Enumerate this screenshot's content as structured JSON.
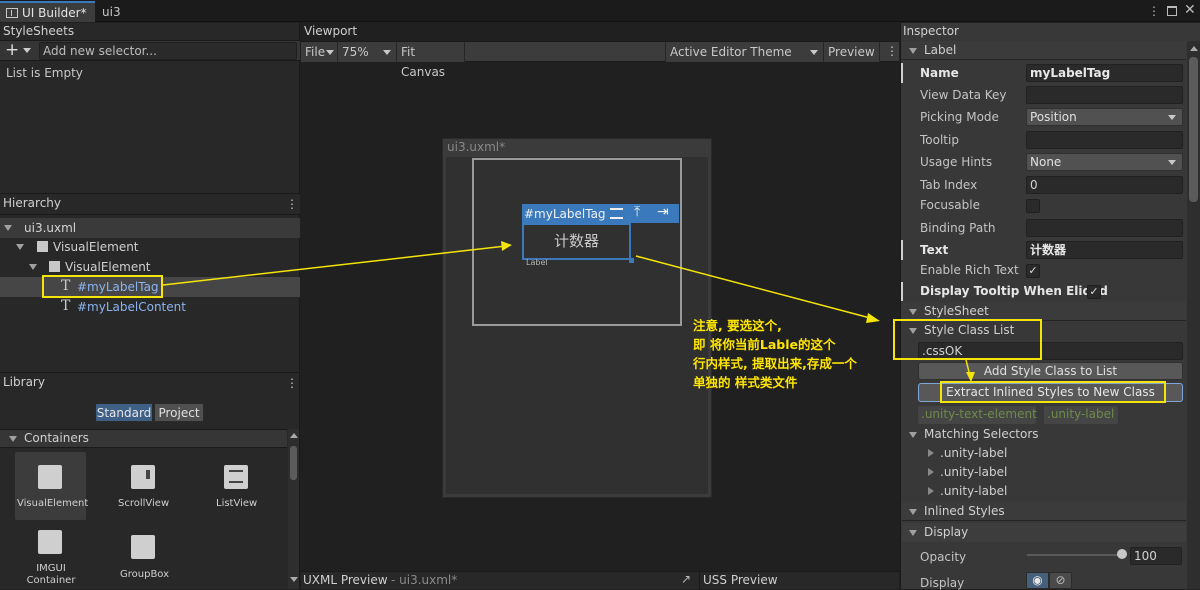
{
  "title_bar": {
    "tab_active": "UI Builder*",
    "tab2": "ui3"
  },
  "stylesheets": {
    "title": "StyleSheets",
    "add_placeholder": "Add new selector...",
    "empty": "List is Empty"
  },
  "hierarchy": {
    "title": "Hierarchy",
    "root": "ui3.uxml",
    "items": [
      "VisualElement",
      "VisualElement",
      "#myLabelTag",
      "#myLabelContent"
    ]
  },
  "library": {
    "title": "Library",
    "tab_standard": "Standard",
    "tab_project": "Project",
    "section": "Containers",
    "items": [
      "VisualElement",
      "ScrollView",
      "ListView",
      "IMGUI Container",
      "GroupBox"
    ]
  },
  "viewport": {
    "title": "Viewport",
    "file_menu": "File",
    "zoom": "75%",
    "fit": "Fit Canvas",
    "theme": "Active Editor Theme",
    "preview": "Preview",
    "canvas_title": "ui3.uxml*",
    "selected_tag": "#myLabelTag",
    "label_text": "计数器",
    "label_caption": "Label"
  },
  "bottom": {
    "uxml_preview": "UXML Preview",
    "uxml_file": "- ui3.uxml*",
    "uss_preview": "USS Preview"
  },
  "annotation": {
    "lines": [
      "注意, 要选这个,",
      "即 将你当前Lable的这个",
      "行内样式, 提取出来,存成一个",
      "单独的 样式类文件"
    ]
  },
  "inspector": {
    "title": "Inspector",
    "label_section": "Label",
    "fields": {
      "name_label": "Name",
      "name_value": "myLabelTag",
      "view_data_key": "View Data Key",
      "picking_mode": "Picking Mode",
      "picking_value": "Position",
      "tooltip": "Tooltip",
      "usage_hints": "Usage Hints",
      "usage_value": "None",
      "tab_index": "Tab Index",
      "tab_value": "0",
      "focusable": "Focusable",
      "binding_path": "Binding Path",
      "text_label": "Text",
      "text_value": "计数器",
      "rich_text": "Enable Rich Text",
      "tooltip_elided": "Display Tooltip When Elided"
    },
    "stylesheet_section": "StyleSheet",
    "style_class_list": "Style Class List",
    "class_input": ".cssOK",
    "add_class_btn": "Add Style Class to List",
    "extract_btn": "Extract Inlined Styles to New Class",
    "chips": [
      ".unity-text-element",
      ".unity-label"
    ],
    "matching": "Matching Selectors",
    "selectors": [
      ".unity-label",
      ".unity-label",
      ".unity-label"
    ],
    "inlined": "Inlined Styles",
    "display_section": "Display",
    "opacity_label": "Opacity",
    "opacity_value": "100",
    "display_label": "Display"
  },
  "colors": {
    "accent_blue": "#3a79bb",
    "highlight_yellow": "#f5e40a",
    "annotation_text": "#ffe600"
  }
}
